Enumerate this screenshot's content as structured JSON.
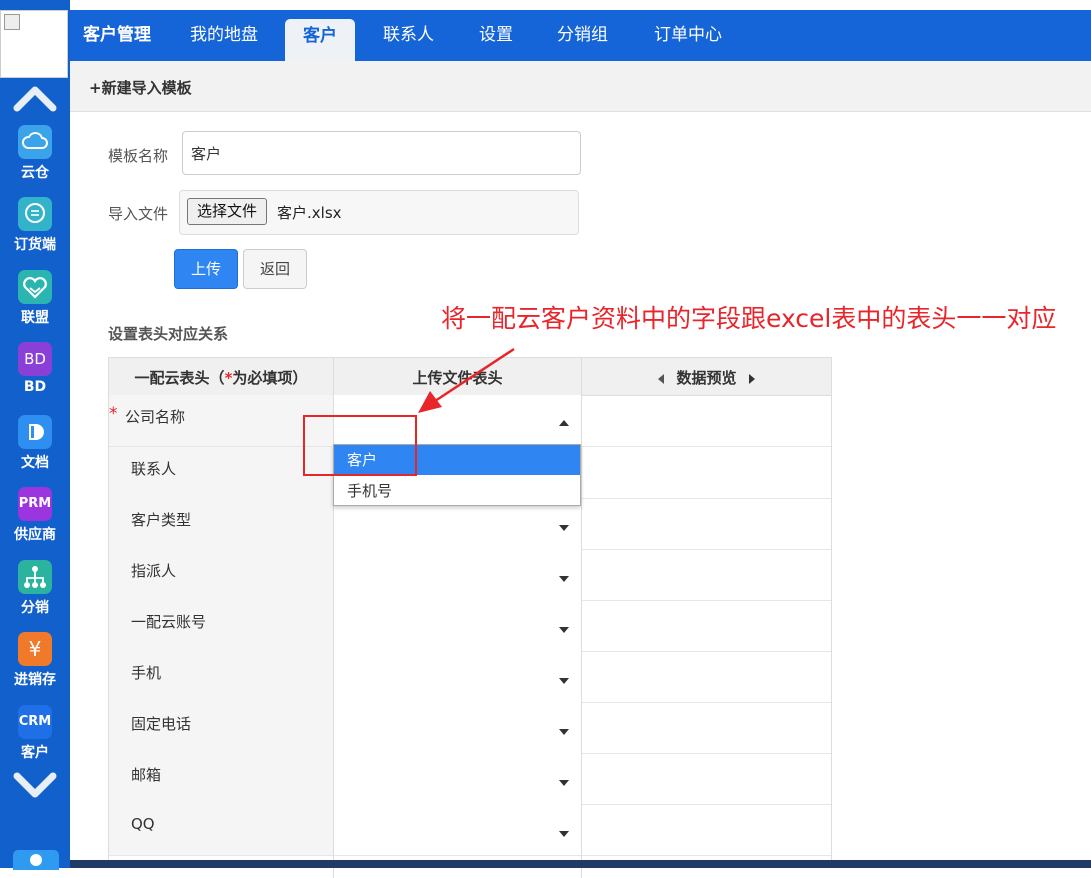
{
  "sidebar": {
    "items": [
      {
        "label": "云仓",
        "icon": "cloud-icon",
        "color": "#3ba3ea"
      },
      {
        "label": "订货端",
        "icon": "chat-icon",
        "color": "#33b3c9"
      },
      {
        "label": "联盟",
        "icon": "handshake-heart-icon",
        "color": "#2ab5b0"
      },
      {
        "label": "BD",
        "icon": "bd-icon",
        "color": "#8a3fd6",
        "icon_text": "BD"
      },
      {
        "label": "文档",
        "icon": "document-icon",
        "color": "#2f8ff0"
      },
      {
        "label": "供应商",
        "icon": "prm-icon",
        "color": "#9b35e0",
        "icon_text": "PRM"
      },
      {
        "label": "分销",
        "icon": "org-tree-icon",
        "color": "#2bb3a0"
      },
      {
        "label": "进销存",
        "icon": "yen-icon",
        "color": "#f07a2a",
        "icon_text": "¥"
      },
      {
        "label": "客户",
        "icon": "crm-icon",
        "color": "#1f6fe6",
        "icon_text": "CRM"
      }
    ]
  },
  "topnav": {
    "brand": "客户管理",
    "tabs": [
      "我的地盘",
      "客户",
      "联系人",
      "设置",
      "分销组",
      "订单中心"
    ],
    "active_tab": "客户"
  },
  "title_bar": {
    "text": "+新建导入模板"
  },
  "form": {
    "template_name_label": "模板名称",
    "template_name_value": "客户",
    "import_file_label": "导入文件",
    "choose_file_button": "选择文件",
    "file_name": "客户.xlsx",
    "upload_button": "上传",
    "back_button": "返回"
  },
  "mapping": {
    "section_title": "设置表头对应关系",
    "header_col1_prefix": "一配云表头（",
    "header_col1_star": "*",
    "header_col1_suffix": "为必填项）",
    "header_col2": "上传文件表头",
    "header_col3": "数据预览",
    "rows": [
      {
        "label": "公司名称",
        "required": "*"
      },
      {
        "label": "联系人"
      },
      {
        "label": "客户类型"
      },
      {
        "label": "指派人"
      },
      {
        "label": "一配云账号"
      },
      {
        "label": "手机"
      },
      {
        "label": "固定电话"
      },
      {
        "label": "邮箱"
      },
      {
        "label": "QQ"
      }
    ],
    "dropdown_options": [
      "客户",
      "手机号"
    ],
    "dropdown_selected": "客户"
  },
  "annotation": {
    "text": "将一配云客户资料中的字段跟excel表中的表头一一对应",
    "color": "#e8252a"
  }
}
